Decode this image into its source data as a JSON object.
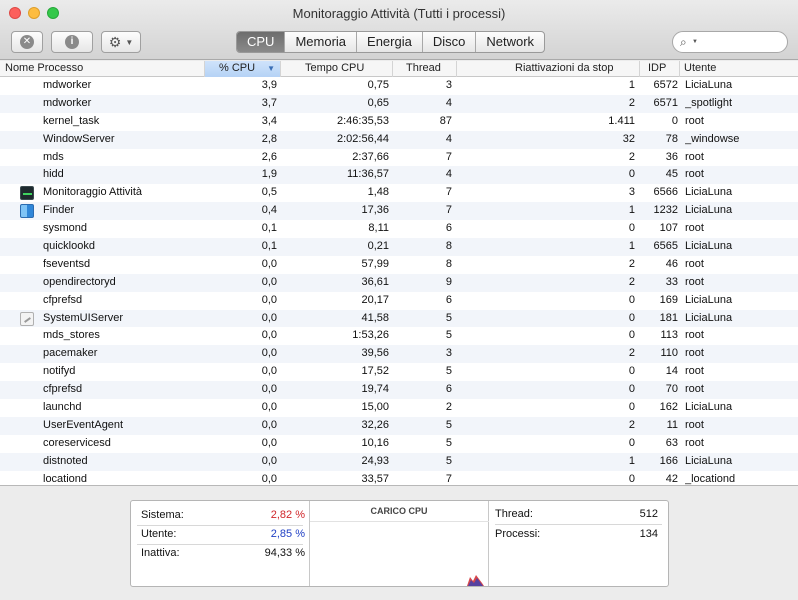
{
  "window": {
    "title": "Monitoraggio Attività (Tutti i processi)"
  },
  "toolbar": {
    "stop_icon": "stop-x-icon",
    "info_icon": "info-icon",
    "gear_icon": "gear-icon",
    "tabs": [
      {
        "label": "CPU",
        "active": true
      },
      {
        "label": "Memoria",
        "active": false
      },
      {
        "label": "Energia",
        "active": false
      },
      {
        "label": "Disco",
        "active": false
      },
      {
        "label": "Network",
        "active": false
      }
    ],
    "search": {
      "placeholder": "",
      "value": ""
    }
  },
  "table": {
    "columns": [
      "Nome Processo",
      "% CPU",
      "Tempo CPU",
      "Thread",
      "Riattivazioni da stop",
      "IDP",
      "Utente"
    ],
    "sort_column": "% CPU",
    "rows": [
      {
        "name": "mdworker",
        "icon": "",
        "cpu": "3,9",
        "time": "0,75",
        "threads": "3",
        "wakeups": "1",
        "pid": "6572",
        "user": "LiciaLuna"
      },
      {
        "name": "mdworker",
        "icon": "",
        "cpu": "3,7",
        "time": "0,65",
        "threads": "4",
        "wakeups": "2",
        "pid": "6571",
        "user": "_spotlight"
      },
      {
        "name": "kernel_task",
        "icon": "",
        "cpu": "3,4",
        "time": "2:46:35,53",
        "threads": "87",
        "wakeups": "1.411",
        "pid": "0",
        "user": "root"
      },
      {
        "name": "WindowServer",
        "icon": "",
        "cpu": "2,8",
        "time": "2:02:56,44",
        "threads": "4",
        "wakeups": "32",
        "pid": "78",
        "user": "_windowse"
      },
      {
        "name": "mds",
        "icon": "",
        "cpu": "2,6",
        "time": "2:37,66",
        "threads": "7",
        "wakeups": "2",
        "pid": "36",
        "user": "root"
      },
      {
        "name": "hidd",
        "icon": "",
        "cpu": "1,9",
        "time": "11:36,57",
        "threads": "4",
        "wakeups": "0",
        "pid": "45",
        "user": "root"
      },
      {
        "name": "Monitoraggio Attività",
        "icon": "monitor",
        "cpu": "0,5",
        "time": "1,48",
        "threads": "7",
        "wakeups": "3",
        "pid": "6566",
        "user": "LiciaLuna"
      },
      {
        "name": "Finder",
        "icon": "finder",
        "cpu": "0,4",
        "time": "17,36",
        "threads": "7",
        "wakeups": "1",
        "pid": "1232",
        "user": "LiciaLuna"
      },
      {
        "name": "sysmond",
        "icon": "",
        "cpu": "0,1",
        "time": "8,11",
        "threads": "6",
        "wakeups": "0",
        "pid": "107",
        "user": "root"
      },
      {
        "name": "quicklookd",
        "icon": "",
        "cpu": "0,1",
        "time": "0,21",
        "threads": "8",
        "wakeups": "1",
        "pid": "6565",
        "user": "LiciaLuna"
      },
      {
        "name": "fseventsd",
        "icon": "",
        "cpu": "0,0",
        "time": "57,99",
        "threads": "8",
        "wakeups": "2",
        "pid": "46",
        "user": "root"
      },
      {
        "name": "opendirectoryd",
        "icon": "",
        "cpu": "0,0",
        "time": "36,61",
        "threads": "9",
        "wakeups": "2",
        "pid": "33",
        "user": "root"
      },
      {
        "name": "cfprefsd",
        "icon": "",
        "cpu": "0,0",
        "time": "20,17",
        "threads": "6",
        "wakeups": "0",
        "pid": "169",
        "user": "LiciaLuna"
      },
      {
        "name": "SystemUIServer",
        "icon": "sysui",
        "cpu": "0,0",
        "time": "41,58",
        "threads": "5",
        "wakeups": "0",
        "pid": "181",
        "user": "LiciaLuna"
      },
      {
        "name": "mds_stores",
        "icon": "",
        "cpu": "0,0",
        "time": "1:53,26",
        "threads": "5",
        "wakeups": "0",
        "pid": "113",
        "user": "root"
      },
      {
        "name": "pacemaker",
        "icon": "",
        "cpu": "0,0",
        "time": "39,56",
        "threads": "3",
        "wakeups": "2",
        "pid": "110",
        "user": "root"
      },
      {
        "name": "notifyd",
        "icon": "",
        "cpu": "0,0",
        "time": "17,52",
        "threads": "5",
        "wakeups": "0",
        "pid": "14",
        "user": "root"
      },
      {
        "name": "cfprefsd",
        "icon": "",
        "cpu": "0,0",
        "time": "19,74",
        "threads": "6",
        "wakeups": "0",
        "pid": "70",
        "user": "root"
      },
      {
        "name": "launchd",
        "icon": "",
        "cpu": "0,0",
        "time": "15,00",
        "threads": "2",
        "wakeups": "0",
        "pid": "162",
        "user": "LiciaLuna"
      },
      {
        "name": "UserEventAgent",
        "icon": "",
        "cpu": "0,0",
        "time": "32,26",
        "threads": "5",
        "wakeups": "2",
        "pid": "11",
        "user": "root"
      },
      {
        "name": "coreservicesd",
        "icon": "",
        "cpu": "0,0",
        "time": "10,16",
        "threads": "5",
        "wakeups": "0",
        "pid": "63",
        "user": "root"
      },
      {
        "name": "distnoted",
        "icon": "",
        "cpu": "0,0",
        "time": "24,93",
        "threads": "5",
        "wakeups": "1",
        "pid": "166",
        "user": "LiciaLuna"
      },
      {
        "name": "locationd",
        "icon": "",
        "cpu": "0,0",
        "time": "33,57",
        "threads": "7",
        "wakeups": "0",
        "pid": "42",
        "user": "_locationd"
      }
    ]
  },
  "stats": {
    "sistema_label": "Sistema:",
    "sistema_value": "2,82 %",
    "utente_label": "Utente:",
    "utente_value": "2,85 %",
    "inattiva_label": "Inattiva:",
    "inattiva_value": "94,33 %",
    "graph_title": "CARICO CPU",
    "thread_label": "Thread:",
    "thread_value": "512",
    "processi_label": "Processi:",
    "processi_value": "134",
    "colors": {
      "sistema": "#d0262a",
      "utente": "#1f3fc4"
    }
  }
}
